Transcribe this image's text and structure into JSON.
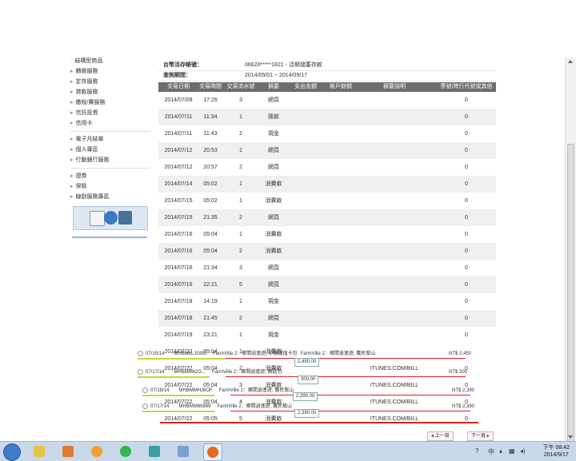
{
  "sidebar": {
    "items_top": [
      "結構型商品",
      "轉帳服務",
      "定存服務",
      "貸款服務",
      "繳稅/費服務",
      "信託投資",
      "信用卡"
    ],
    "items_mid": [
      "電子月結單",
      "個人專區",
      "行動銀行服務"
    ],
    "items_bottom": [
      "證券",
      "保險",
      "線創服務專區"
    ]
  },
  "account": {
    "label": "台幣活存帳號：",
    "value": "06620*****1821 - 活期儲蓄存款",
    "period_label": "查詢期間：",
    "period_value": "2014/05/01 ~ 2014/09/17"
  },
  "table": {
    "headers": [
      "交易日期",
      "交易時間",
      "交易流水號",
      "摘要",
      "支出金額",
      "帳戶餘額",
      "摘要說明",
      "票號/跨行代號或其他"
    ],
    "rows": [
      {
        "date": "2014/07/09",
        "time": "17:26",
        "seq": "3",
        "memo": "網頁",
        "other": "0"
      },
      {
        "date": "2014/07/11",
        "time": "11:34",
        "seq": "1",
        "memo": "匯款",
        "other": "0"
      },
      {
        "date": "2014/07/11",
        "time": "11:43",
        "seq": "2",
        "memo": "現金",
        "other": "0"
      },
      {
        "date": "2014/07/12",
        "time": "20:53",
        "seq": "1",
        "memo": "網頁",
        "other": "0"
      },
      {
        "date": "2014/07/12",
        "time": "20:57",
        "seq": "2",
        "memo": "網頁",
        "other": "0"
      },
      {
        "date": "2014/07/14",
        "time": "05:02",
        "seq": "1",
        "memo": "消費款",
        "other": "0"
      },
      {
        "date": "2014/07/15",
        "time": "05:02",
        "seq": "1",
        "memo": "消費款",
        "other": "0"
      },
      {
        "date": "2014/07/15",
        "time": "21:35",
        "seq": "2",
        "memo": "網頁",
        "other": "0"
      },
      {
        "date": "2014/07/16",
        "time": "05:04",
        "seq": "1",
        "memo": "消費款",
        "other": "0"
      },
      {
        "date": "2014/07/16",
        "time": "05:04",
        "seq": "2",
        "memo": "消費款",
        "other": "0"
      },
      {
        "date": "2014/07/16",
        "time": "21:34",
        "seq": "3",
        "memo": "網頁",
        "other": "0"
      },
      {
        "date": "2014/07/16",
        "time": "22:21",
        "seq": "5",
        "memo": "網頁",
        "other": "0"
      },
      {
        "date": "2014/07/18",
        "time": "14:19",
        "seq": "1",
        "memo": "現金",
        "other": "0"
      },
      {
        "date": "2014/07/18",
        "time": "21:45",
        "seq": "2",
        "memo": "網頁",
        "other": "0"
      },
      {
        "date": "2014/07/19",
        "time": "23:21",
        "seq": "1",
        "memo": "現金",
        "other": "0"
      }
    ],
    "extra_rows": [
      {
        "date": "2014/07/22",
        "time": "05:04",
        "seq": "1",
        "memo": "消費款",
        "desc": "",
        "other": ""
      },
      {
        "date": "2014/07/22",
        "time": "05:04",
        "seq": "2",
        "memo": "消費款",
        "desc": "ITUNES.COM/BILL",
        "other": "0"
      },
      {
        "date": "2014/07/22",
        "time": "05:04",
        "seq": "3",
        "memo": "消費款",
        "desc": "ITUNES.COM/BILL",
        "other": "0"
      },
      {
        "date": "2014/07/22",
        "time": "05:04",
        "seq": "4",
        "memo": "消費款",
        "desc": "ITUNES.COM/BILL",
        "other": "0"
      },
      {
        "date": "2014/07/22",
        "time": "05:05",
        "seq": "5",
        "memo": "消費款",
        "desc": "ITUNES.COM/BILL",
        "other": "0"
      }
    ]
  },
  "overlays": [
    {
      "date": "07/15/14",
      "code": "MHBMLLJG9G",
      "desc": "FarmVille 2：鄉間逍遙遊, 小額儲值卡包",
      "desc2": "FarmVille 2：鄉間逍遙遊, 農民幫山",
      "amount": "NT$ 2,450"
    },
    {
      "date": "07/17/14",
      "code": "MHBMM62G...",
      "desc": "FarmVille 2：鄉間逍遙遊, 綿話包",
      "amount": "NT$ 300"
    },
    {
      "date": "07/18/14",
      "code": "MHBMMHJ8OF",
      "desc": "FarmVille 2：鄉間逍遙遊, 農民幫山",
      "amount": "NT$ 2,390"
    },
    {
      "date": "07/17/14",
      "code": "MHBMM60869",
      "desc": "FarmVille 2：鄉間逍遙遊, 農民幫山",
      "amount": "NT$ 2,390"
    }
  ],
  "pills": [
    "2,450.00",
    "300.00",
    "2,390.00",
    "2,390.00"
  ],
  "pager": {
    "prev": "◂ 上一頁",
    "next": "下一頁 ▸"
  },
  "taskbar": {
    "time": "下午 08:42",
    "date": "2014/9/17",
    "icons": [
      "explorer-icon",
      "media-player-icon",
      "chat-bubble-icon",
      "line-app-icon",
      "text-editor-icon",
      "tool-icon",
      "firefox-icon"
    ]
  }
}
